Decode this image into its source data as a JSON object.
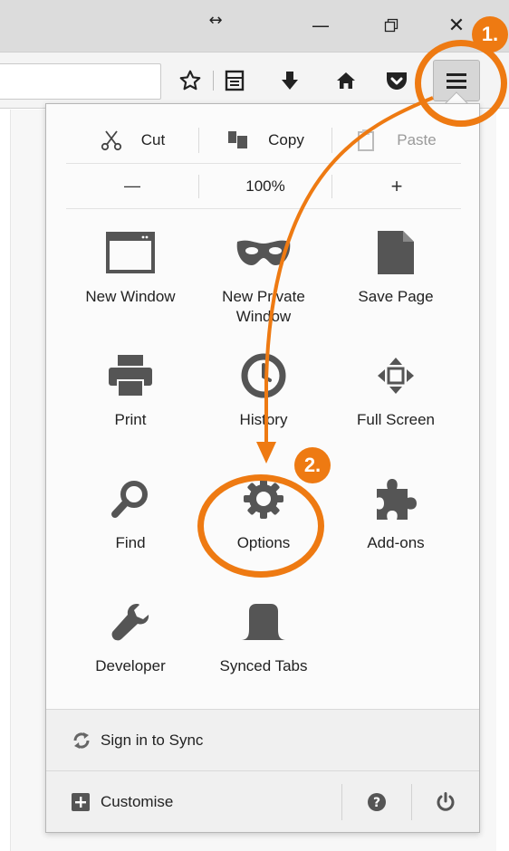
{
  "window_controls": {
    "resize": "↔",
    "minimize": "—",
    "close": "✕"
  },
  "toolbar_icons": [
    "bookmark-star-icon",
    "reading-list-icon",
    "downloads-icon",
    "home-icon",
    "pocket-icon",
    "hamburger-menu-icon"
  ],
  "menu": {
    "edit": {
      "cut": "Cut",
      "copy": "Copy",
      "paste": "Paste"
    },
    "zoom": {
      "out": "—",
      "level": "100%",
      "in": "+"
    },
    "items": [
      {
        "label": "New Window",
        "icon": "new-window-icon"
      },
      {
        "label": "New Private\nWindow",
        "icon": "private-mask-icon"
      },
      {
        "label": "Save Page",
        "icon": "save-page-icon"
      },
      {
        "label": "Print",
        "icon": "printer-icon"
      },
      {
        "label": "History",
        "icon": "history-clock-icon"
      },
      {
        "label": "Full Screen",
        "icon": "full-screen-icon"
      },
      {
        "label": "Find",
        "icon": "magnifier-icon"
      },
      {
        "label": "Options",
        "icon": "gear-icon"
      },
      {
        "label": "Add-ons",
        "icon": "puzzle-piece-icon"
      },
      {
        "label": "Developer",
        "icon": "wrench-icon"
      },
      {
        "label": "Synced Tabs",
        "icon": "synced-tabs-icon"
      }
    ],
    "sync_label": "Sign in to Sync",
    "customise_label": "Customise"
  },
  "annotations": {
    "step1": "1.",
    "step2": "2.",
    "color": "#ee7a12"
  }
}
